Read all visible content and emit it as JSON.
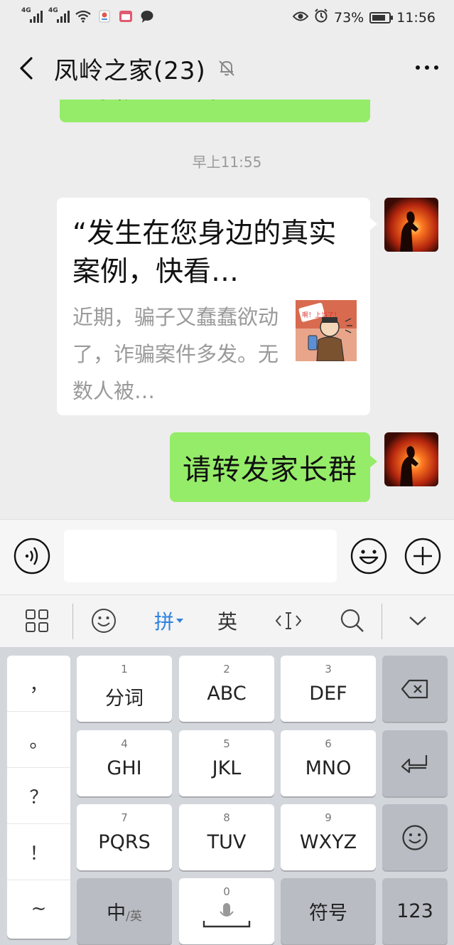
{
  "status_bar": {
    "network_1": "4G",
    "network_2": "4G",
    "battery": "73%",
    "time": "11:56"
  },
  "header": {
    "title": "凤岭之家(23)"
  },
  "chat": {
    "partial_message": "到我身去上米",
    "timestamp": "早上11:55",
    "card": {
      "title": "“发生在您身边的真实案例，快看…",
      "description": "近期，骗子又蠢蠢欲动了，诈骗案件多发。无数人被…",
      "thumb_text": "啊！上当了！"
    },
    "message": "请转发家长群"
  },
  "input": {
    "placeholder": ""
  },
  "keyboard_toolbar": {
    "pinyin_label": "拼",
    "english_label": "英"
  },
  "keyboard": {
    "punctuation": [
      "，",
      "。",
      "？",
      "！",
      "~"
    ],
    "keys": [
      {
        "num": "1",
        "label": "分词"
      },
      {
        "num": "2",
        "label": "ABC"
      },
      {
        "num": "3",
        "label": "DEF"
      },
      {
        "num": "4",
        "label": "GHI"
      },
      {
        "num": "5",
        "label": "JKL"
      },
      {
        "num": "6",
        "label": "MNO"
      },
      {
        "num": "7",
        "label": "PQRS"
      },
      {
        "num": "8",
        "label": "TUV"
      },
      {
        "num": "9",
        "label": "WXYZ"
      }
    ],
    "switch_main": "中",
    "switch_sub": "/英",
    "space_num": "0",
    "symbols": "符号",
    "numbers": "123"
  }
}
